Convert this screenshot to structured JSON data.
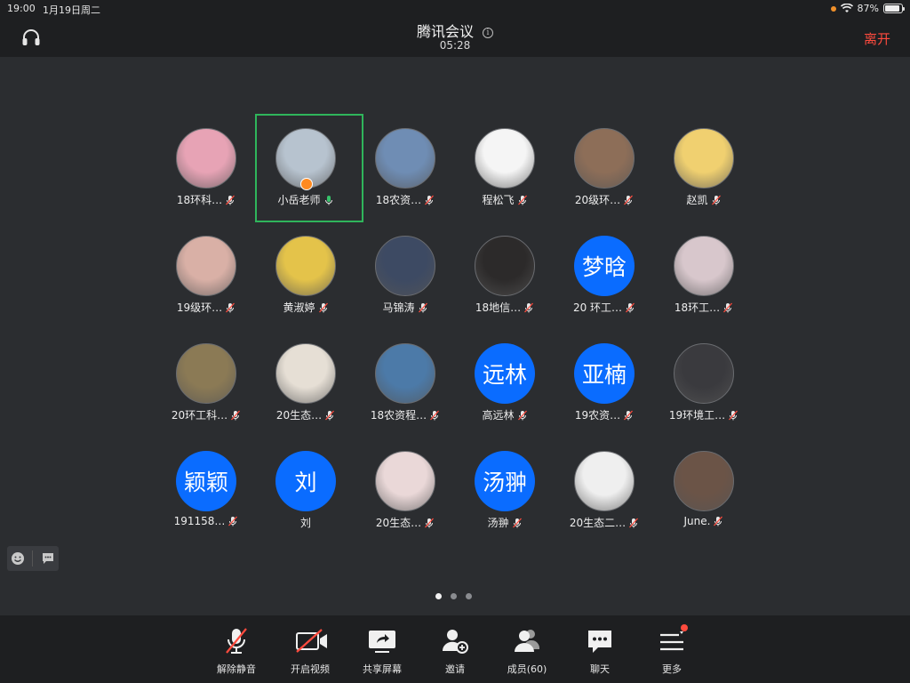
{
  "status_bar": {
    "time": "19:00",
    "date": "1月19日周二",
    "battery": "87%"
  },
  "header": {
    "title": "腾讯会议",
    "duration": "05:28",
    "leave_label": "离开"
  },
  "participants": [
    {
      "name": "18环科…",
      "avatar": "img",
      "color": "#e7a3b5",
      "active": false
    },
    {
      "name": "小岳老师",
      "avatar": "img",
      "color": "#b7c3cf",
      "active": true
    },
    {
      "name": "18农资…",
      "avatar": "img",
      "color": "#6f8db4",
      "active": false
    },
    {
      "name": "程松飞",
      "avatar": "img",
      "color": "#f5f5f5",
      "active": false
    },
    {
      "name": "20级环…",
      "avatar": "img",
      "color": "#8d6e58",
      "active": false
    },
    {
      "name": "赵凯",
      "avatar": "img",
      "color": "#f0d070",
      "active": false
    },
    {
      "name": "19级环…",
      "avatar": "img",
      "color": "#d9b0a6",
      "active": false
    },
    {
      "name": "黄淑婷",
      "avatar": "img",
      "color": "#e4c34a",
      "active": false
    },
    {
      "name": "马锦涛",
      "avatar": "img",
      "color": "#3d4a63",
      "active": false
    },
    {
      "name": "18地信…",
      "avatar": "img",
      "color": "#2c2a2a",
      "active": false
    },
    {
      "name": "20 环工…",
      "avatar": "text",
      "text": "梦晗",
      "active": false
    },
    {
      "name": "18环工…",
      "avatar": "img",
      "color": "#d8c7cc",
      "active": false
    },
    {
      "name": "20环工科…",
      "avatar": "img",
      "color": "#8b7a55",
      "active": false
    },
    {
      "name": "20生态…",
      "avatar": "img",
      "color": "#e6dfd5",
      "active": false
    },
    {
      "name": "18农资程…",
      "avatar": "img",
      "color": "#4c7aa8",
      "active": false
    },
    {
      "name": "高远林",
      "avatar": "text",
      "text": "远林",
      "active": false
    },
    {
      "name": "19农资…",
      "avatar": "text",
      "text": "亚楠",
      "active": false
    },
    {
      "name": "19环境工…",
      "avatar": "img",
      "color": "#3a3a3e",
      "active": false
    },
    {
      "name": "191158…",
      "avatar": "text",
      "text": "颖颖",
      "active": false
    },
    {
      "name": "刘",
      "avatar": "text",
      "text": "刘",
      "active": false,
      "no_mic": true
    },
    {
      "name": "20生态…",
      "avatar": "img",
      "color": "#ead8d8",
      "active": false
    },
    {
      "name": "汤翀",
      "avatar": "text",
      "text": "汤翀",
      "active": false
    },
    {
      "name": "20生态二…",
      "avatar": "img",
      "color": "#efefef",
      "active": false
    },
    {
      "name": "June.",
      "avatar": "img",
      "color": "#6b5447",
      "active": false
    }
  ],
  "toolbar": {
    "unmute": "解除静音",
    "video": "开启视频",
    "share": "共享屏幕",
    "invite": "邀请",
    "members": "成员(60)",
    "chat": "聊天",
    "more": "更多"
  },
  "colors": {
    "accent": "#0a6cff",
    "active_border": "#2fb55b",
    "leave": "#ff4b3e",
    "muted": "#ff4b3e"
  }
}
